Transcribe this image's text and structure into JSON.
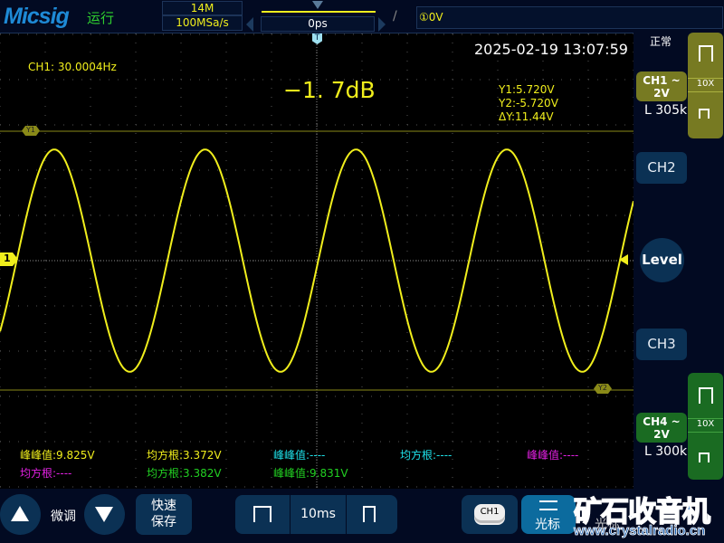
{
  "header": {
    "brand": "Micsig",
    "run_state": "运行",
    "memory_depth": "14M",
    "sample_rate": "100MSa/s",
    "horizontal_position": "0ps",
    "trigger_edge": "/",
    "trigger_level": "①0V"
  },
  "display": {
    "datetime": "2025-02-19 13:07:59",
    "frequency": "CH1: 30.0004Hz",
    "gain_db": "−1. 7dB",
    "trigger_marker": "T",
    "ch1_marker": "1",
    "cursors": {
      "y1_label": "Y1",
      "y2_label": "Y2",
      "y1": "Y1:5.720V",
      "y2": "Y2:-5.720V",
      "dy": "ΔY:11.44V"
    },
    "measurements": [
      {
        "text": "峰峰值:9.825V",
        "color": "#f0ee1c"
      },
      {
        "text": "均方根:3.372V",
        "color": "#f0ee1c"
      },
      {
        "text": "峰峰值:----",
        "color": "#1ee0e8"
      },
      {
        "text": "均方根:----",
        "color": "#1ee0e8"
      },
      {
        "text": "峰峰值:----",
        "color": "#e020e0"
      },
      {
        "text": "均方根:----",
        "color": "#e020e0"
      },
      {
        "text": "均方根:3.382V",
        "color": "#22d022"
      },
      {
        "text": "峰峰值:9.831V",
        "color": "#22d022"
      }
    ]
  },
  "waveform": {
    "channel": "CH1",
    "frequency_hz": 30.0004,
    "timebase_ms_per_div": 10,
    "volts_per_div": 2,
    "color": "#f0ee1c"
  },
  "right_panel": {
    "acq_mode": "正常",
    "ch1": {
      "label": "CH1",
      "coupling": "~",
      "scale": "2V",
      "impedance": "L 305k",
      "probe": "10X",
      "color": "#777a22"
    },
    "ch2": "CH2",
    "level": "Level",
    "ch3": "CH3",
    "ch4": {
      "label": "CH4",
      "coupling": "~",
      "scale": "2V",
      "impedance": "L 300k",
      "probe": "10X",
      "color": "#1a6b22"
    }
  },
  "bottom": {
    "fine_adjust": "微调",
    "quick_save": [
      "快速",
      "保存"
    ],
    "timebase": "10ms",
    "ch1_select": "CH1",
    "cursor_label": "光标",
    "cursor_label2": "光标"
  },
  "watermark": {
    "title": "矿石收音机",
    "url": "www.crystalradio.cn"
  }
}
